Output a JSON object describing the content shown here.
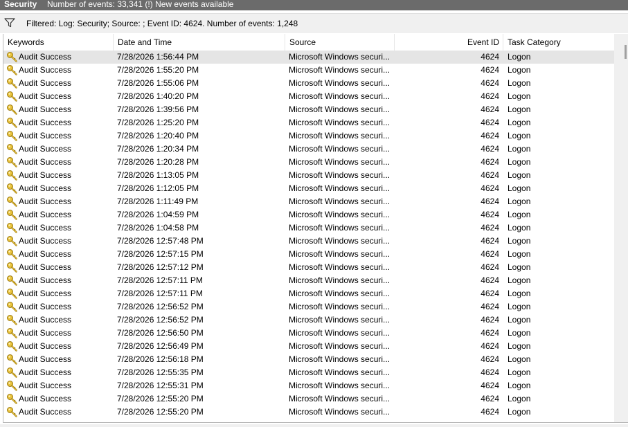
{
  "titlebar": {
    "log_name": "Security",
    "info": "Number of events: 33,341 (!) New events available"
  },
  "filter": {
    "icon": "filter-funnel-icon",
    "text": "Filtered: Log: Security; Source: ; Event ID: 4624. Number of events: 1,248"
  },
  "columns": {
    "keywords": "Keywords",
    "date_time": "Date and Time",
    "source": "Source",
    "event_id": "Event ID",
    "task_category": "Task Category"
  },
  "row_icon": "key-icon",
  "events": [
    {
      "keywords": "Audit Success",
      "date_time": "7/28/2026 1:56:44 PM",
      "source": "Microsoft Windows securi...",
      "event_id": "4624",
      "task_category": "Logon"
    },
    {
      "keywords": "Audit Success",
      "date_time": "7/28/2026 1:55:20 PM",
      "source": "Microsoft Windows securi...",
      "event_id": "4624",
      "task_category": "Logon"
    },
    {
      "keywords": "Audit Success",
      "date_time": "7/28/2026 1:55:06 PM",
      "source": "Microsoft Windows securi...",
      "event_id": "4624",
      "task_category": "Logon"
    },
    {
      "keywords": "Audit Success",
      "date_time": "7/28/2026 1:40:20 PM",
      "source": "Microsoft Windows securi...",
      "event_id": "4624",
      "task_category": "Logon"
    },
    {
      "keywords": "Audit Success",
      "date_time": "7/28/2026 1:39:56 PM",
      "source": "Microsoft Windows securi...",
      "event_id": "4624",
      "task_category": "Logon"
    },
    {
      "keywords": "Audit Success",
      "date_time": "7/28/2026 1:25:20 PM",
      "source": "Microsoft Windows securi...",
      "event_id": "4624",
      "task_category": "Logon"
    },
    {
      "keywords": "Audit Success",
      "date_time": "7/28/2026 1:20:40 PM",
      "source": "Microsoft Windows securi...",
      "event_id": "4624",
      "task_category": "Logon"
    },
    {
      "keywords": "Audit Success",
      "date_time": "7/28/2026 1:20:34 PM",
      "source": "Microsoft Windows securi...",
      "event_id": "4624",
      "task_category": "Logon"
    },
    {
      "keywords": "Audit Success",
      "date_time": "7/28/2026 1:20:28 PM",
      "source": "Microsoft Windows securi...",
      "event_id": "4624",
      "task_category": "Logon"
    },
    {
      "keywords": "Audit Success",
      "date_time": "7/28/2026 1:13:05 PM",
      "source": "Microsoft Windows securi...",
      "event_id": "4624",
      "task_category": "Logon"
    },
    {
      "keywords": "Audit Success",
      "date_time": "7/28/2026 1:12:05 PM",
      "source": "Microsoft Windows securi...",
      "event_id": "4624",
      "task_category": "Logon"
    },
    {
      "keywords": "Audit Success",
      "date_time": "7/28/2026 1:11:49 PM",
      "source": "Microsoft Windows securi...",
      "event_id": "4624",
      "task_category": "Logon"
    },
    {
      "keywords": "Audit Success",
      "date_time": "7/28/2026 1:04:59 PM",
      "source": "Microsoft Windows securi...",
      "event_id": "4624",
      "task_category": "Logon"
    },
    {
      "keywords": "Audit Success",
      "date_time": "7/28/2026 1:04:58 PM",
      "source": "Microsoft Windows securi...",
      "event_id": "4624",
      "task_category": "Logon"
    },
    {
      "keywords": "Audit Success",
      "date_time": "7/28/2026 12:57:48 PM",
      "source": "Microsoft Windows securi...",
      "event_id": "4624",
      "task_category": "Logon"
    },
    {
      "keywords": "Audit Success",
      "date_time": "7/28/2026 12:57:15 PM",
      "source": "Microsoft Windows securi...",
      "event_id": "4624",
      "task_category": "Logon"
    },
    {
      "keywords": "Audit Success",
      "date_time": "7/28/2026 12:57:12 PM",
      "source": "Microsoft Windows securi...",
      "event_id": "4624",
      "task_category": "Logon"
    },
    {
      "keywords": "Audit Success",
      "date_time": "7/28/2026 12:57:11 PM",
      "source": "Microsoft Windows securi...",
      "event_id": "4624",
      "task_category": "Logon"
    },
    {
      "keywords": "Audit Success",
      "date_time": "7/28/2026 12:57:11 PM",
      "source": "Microsoft Windows securi...",
      "event_id": "4624",
      "task_category": "Logon"
    },
    {
      "keywords": "Audit Success",
      "date_time": "7/28/2026 12:56:52 PM",
      "source": "Microsoft Windows securi...",
      "event_id": "4624",
      "task_category": "Logon"
    },
    {
      "keywords": "Audit Success",
      "date_time": "7/28/2026 12:56:52 PM",
      "source": "Microsoft Windows securi...",
      "event_id": "4624",
      "task_category": "Logon"
    },
    {
      "keywords": "Audit Success",
      "date_time": "7/28/2026 12:56:50 PM",
      "source": "Microsoft Windows securi...",
      "event_id": "4624",
      "task_category": "Logon"
    },
    {
      "keywords": "Audit Success",
      "date_time": "7/28/2026 12:56:49 PM",
      "source": "Microsoft Windows securi...",
      "event_id": "4624",
      "task_category": "Logon"
    },
    {
      "keywords": "Audit Success",
      "date_time": "7/28/2026 12:56:18 PM",
      "source": "Microsoft Windows securi...",
      "event_id": "4624",
      "task_category": "Logon"
    },
    {
      "keywords": "Audit Success",
      "date_time": "7/28/2026 12:55:35 PM",
      "source": "Microsoft Windows securi...",
      "event_id": "4624",
      "task_category": "Logon"
    },
    {
      "keywords": "Audit Success",
      "date_time": "7/28/2026 12:55:31 PM",
      "source": "Microsoft Windows securi...",
      "event_id": "4624",
      "task_category": "Logon"
    },
    {
      "keywords": "Audit Success",
      "date_time": "7/28/2026 12:55:20 PM",
      "source": "Microsoft Windows securi...",
      "event_id": "4624",
      "task_category": "Logon"
    },
    {
      "keywords": "Audit Success",
      "date_time": "7/28/2026 12:55:20 PM",
      "source": "Microsoft Windows securi...",
      "event_id": "4624",
      "task_category": "Logon"
    }
  ]
}
